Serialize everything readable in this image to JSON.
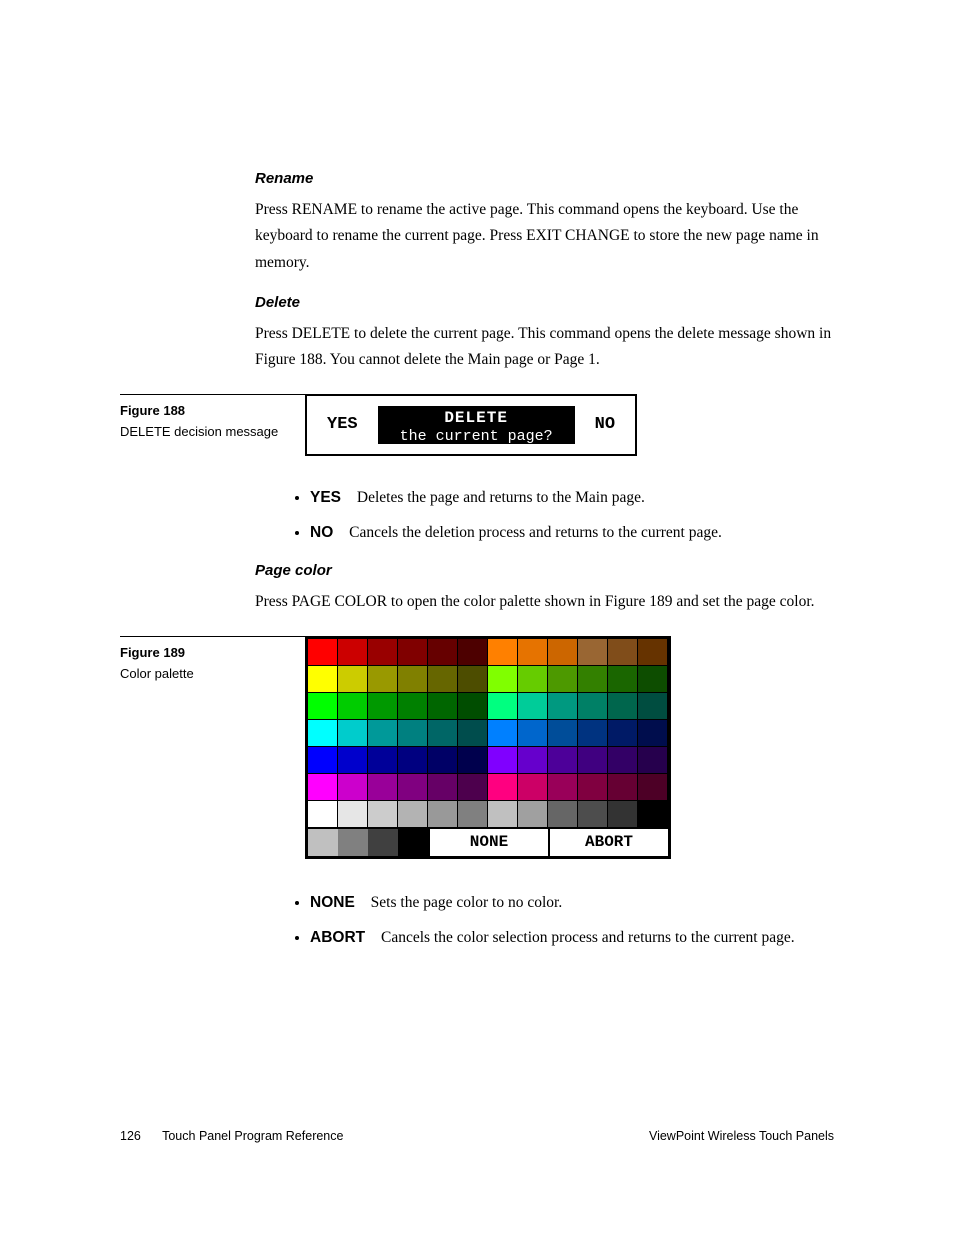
{
  "sections": {
    "rename": {
      "heading": "Rename",
      "body": "Press RENAME to rename the active page. This command opens the keyboard. Use the keyboard to rename the current page. Press EXIT CHANGE to store the new page name in memory."
    },
    "delete": {
      "heading": "Delete",
      "body": "Press DELETE to delete the current page. This command opens the delete message shown in Figure 188. You cannot delete the Main page or Page 1."
    },
    "pagecolor": {
      "heading": "Page color",
      "body": "Press PAGE COLOR to open the color palette shown in Figure 189 and set the page color."
    }
  },
  "fig188": {
    "number": "Figure 188",
    "caption": "DELETE decision message",
    "yes": "YES",
    "no": "NO",
    "line1": "DELETE",
    "line2": "the current page?"
  },
  "bullets188": {
    "yes_term": "YES",
    "yes_text": "Deletes the page and returns to the Main page.",
    "no_term": "NO",
    "no_text": "Cancels the deletion process and returns to the current page."
  },
  "fig189": {
    "number": "Figure 189",
    "caption": "Color palette",
    "none": "NONE",
    "abort": "ABORT",
    "rows": [
      [
        "#ff0000",
        "#cc0000",
        "#990000",
        "#800000",
        "#660000",
        "#4d0000",
        "#ff8000",
        "#e67300",
        "#cc6600",
        "#996633",
        "#804d1a",
        "#663300"
      ],
      [
        "#ffff00",
        "#cccc00",
        "#999900",
        "#808000",
        "#666600",
        "#4d4d00",
        "#80ff00",
        "#66cc00",
        "#4d9900",
        "#338000",
        "#1a6600",
        "#0d4d00"
      ],
      [
        "#00ff00",
        "#00cc00",
        "#009900",
        "#008000",
        "#006600",
        "#004d00",
        "#00ff80",
        "#00cc99",
        "#009980",
        "#008066",
        "#00664d",
        "#004d40"
      ],
      [
        "#00ffff",
        "#00cccc",
        "#009999",
        "#008080",
        "#006666",
        "#004d4d",
        "#0080ff",
        "#0066cc",
        "#004d99",
        "#003380",
        "#001a66",
        "#000d4d"
      ],
      [
        "#0000ff",
        "#0000cc",
        "#000099",
        "#000080",
        "#000066",
        "#00004d",
        "#8000ff",
        "#6600cc",
        "#4d0099",
        "#400080",
        "#330066",
        "#26004d"
      ],
      [
        "#ff00ff",
        "#cc00cc",
        "#990099",
        "#800080",
        "#660066",
        "#4d004d",
        "#ff0080",
        "#cc0066",
        "#990059",
        "#800040",
        "#660033",
        "#4d0026"
      ],
      [
        "#ffffff",
        "#e6e6e6",
        "#cccccc",
        "#b3b3b3",
        "#999999",
        "#808080",
        "#c0c0c0",
        "#a0a0a0",
        "#666666",
        "#4d4d4d",
        "#333333",
        "#000000"
      ]
    ]
  },
  "bullets189": {
    "none_term": "NONE",
    "none_text": "Sets the page color to no color.",
    "abort_term": "ABORT",
    "abort_text": "Cancels the color selection process and returns to the current page."
  },
  "footer": {
    "page_num": "126",
    "left": "Touch Panel Program Reference",
    "right": "ViewPoint Wireless Touch Panels"
  }
}
